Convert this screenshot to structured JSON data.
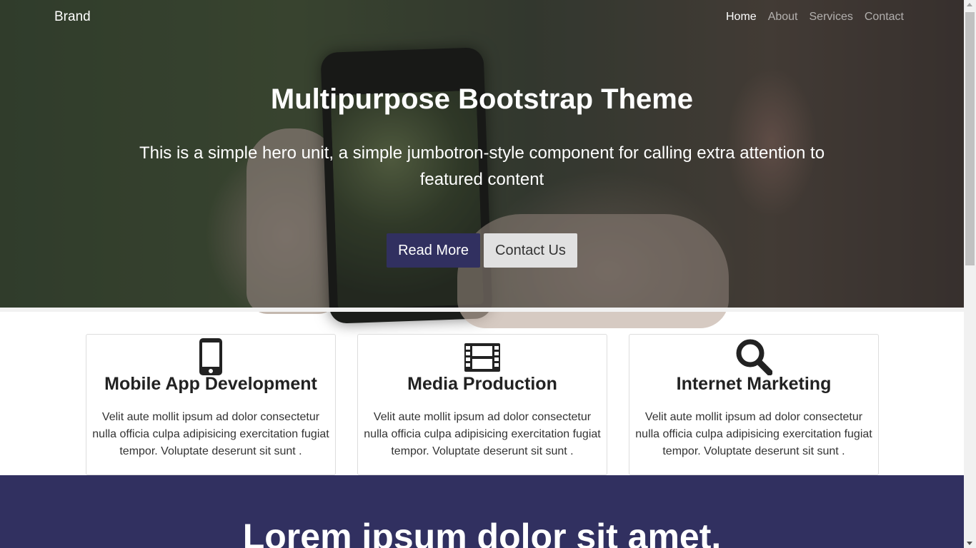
{
  "nav": {
    "brand": "Brand",
    "links": [
      {
        "label": "Home",
        "active": true
      },
      {
        "label": "About",
        "active": false
      },
      {
        "label": "Services",
        "active": false
      },
      {
        "label": "Contact",
        "active": false
      }
    ]
  },
  "hero": {
    "title": "Multipurpose Bootstrap Theme",
    "lead": "This is a simple hero unit, a simple jumbotron-style component for calling extra attention to featured content",
    "primary_button": "Read More",
    "secondary_button": "Contact Us"
  },
  "features": [
    {
      "icon": "mobile-phone-icon",
      "title": "Mobile App Development",
      "text": "Velit aute mollit ipsum ad dolor consectetur nulla officia culpa adipisicing exercitation fugiat tempor. Voluptate deserunt sit sunt ."
    },
    {
      "icon": "film-icon",
      "title": "Media Production",
      "text": "Velit aute mollit ipsum ad dolor consectetur nulla officia culpa adipisicing exercitation fugiat tempor. Voluptate deserunt sit sunt ."
    },
    {
      "icon": "search-icon",
      "title": "Internet Marketing",
      "text": "Velit aute mollit ipsum ad dolor consectetur nulla officia culpa adipisicing exercitation fugiat tempor. Voluptate deserunt sit sunt ."
    }
  ],
  "band": {
    "title": "Lorem ipsum dolor sit amet."
  },
  "colors": {
    "primary": "#313060",
    "light_button": "#e1e1e1",
    "text_dark": "#222222"
  }
}
